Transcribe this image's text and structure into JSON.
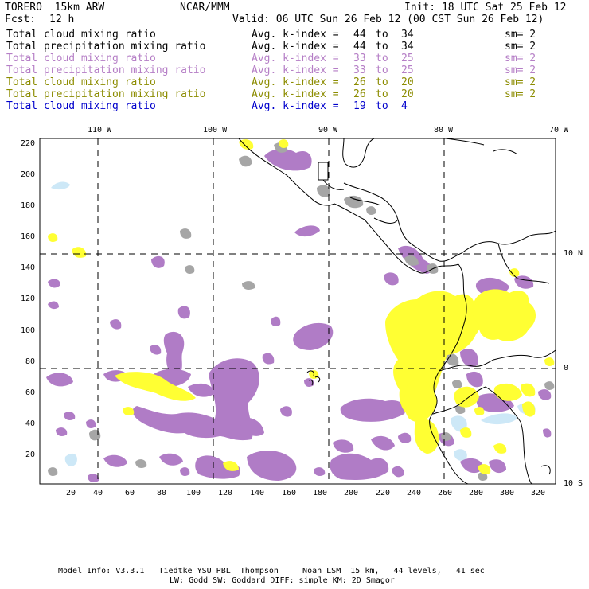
{
  "header": {
    "title_left": "TORERO  15km ARW",
    "title_center": "NCAR/MMM",
    "init": "Init: 18 UTC Sat 25 Feb 12",
    "fcst_label": "Fcst:",
    "fcst_value": "12 h",
    "valid": "Valid: 06 UTC Sun 26 Feb 12 (00 CST Sun 26 Feb 12)"
  },
  "legend": [
    {
      "field": "Total cloud mixing ratio",
      "kindex": "Avg. k-index =",
      "range_lo": "44",
      "to": "to",
      "range_hi": "34",
      "sm": "sm= 2",
      "color": "#000000"
    },
    {
      "field": "Total precipitation mixing ratio",
      "kindex": "Avg. k-index =",
      "range_lo": "44",
      "to": "to",
      "range_hi": "34",
      "sm": "sm= 2",
      "color": "#000000"
    },
    {
      "field": "Total cloud mixing ratio",
      "kindex": "Avg. k-index =",
      "range_lo": "33",
      "to": "to",
      "range_hi": "25",
      "sm": "sm= 2",
      "color": "#b57ec6"
    },
    {
      "field": "Total precipitation mixing ratio",
      "kindex": "Avg. k-index =",
      "range_lo": "33",
      "to": "to",
      "range_hi": "25",
      "sm": "sm= 2",
      "color": "#b57ec6"
    },
    {
      "field": "Total cloud mixing ratio",
      "kindex": "Avg. k-index =",
      "range_lo": "26",
      "to": "to",
      "range_hi": "20",
      "sm": "sm= 2",
      "color": "#8c8c00"
    },
    {
      "field": "Total precipitation mixing ratio",
      "kindex": "Avg. k-index =",
      "range_lo": "26",
      "to": "to",
      "range_hi": "20",
      "sm": "sm= 2",
      "color": "#8c8c00"
    },
    {
      "field": "Total cloud mixing ratio",
      "kindex": "Avg. k-index =",
      "range_lo": "19",
      "to": "to",
      "range_hi": "4",
      "sm": "",
      "color": "#0000cc"
    }
  ],
  "map": {
    "top_ticks": [
      "110 W",
      "100 W",
      "90 W",
      "80 W",
      "70 W"
    ],
    "right_ticks": [
      "10 N",
      "0",
      "10 S"
    ],
    "left_ticks": [
      "220",
      "200",
      "180",
      "160",
      "140",
      "120",
      "100",
      "80",
      "60",
      "40",
      "20"
    ],
    "bottom_ticks": [
      "20",
      "40",
      "60",
      "80",
      "100",
      "120",
      "140",
      "160",
      "180",
      "200",
      "220",
      "240",
      "260",
      "280",
      "300",
      "320"
    ],
    "colors": {
      "gray": "#a6a6a6",
      "purple": "#b07cc6",
      "yellow": "#ffff33",
      "lightblue": "#cde8f7",
      "coast": "#000000"
    }
  },
  "footer": {
    "line1": "Model Info: V3.3.1   Tiedtke YSU PBL  Thompson     Noah LSM  15 km,   44 levels,   41 sec",
    "line2": "LW: Godd SW: Goddard DIFF: simple KM: 2D Smagor"
  }
}
